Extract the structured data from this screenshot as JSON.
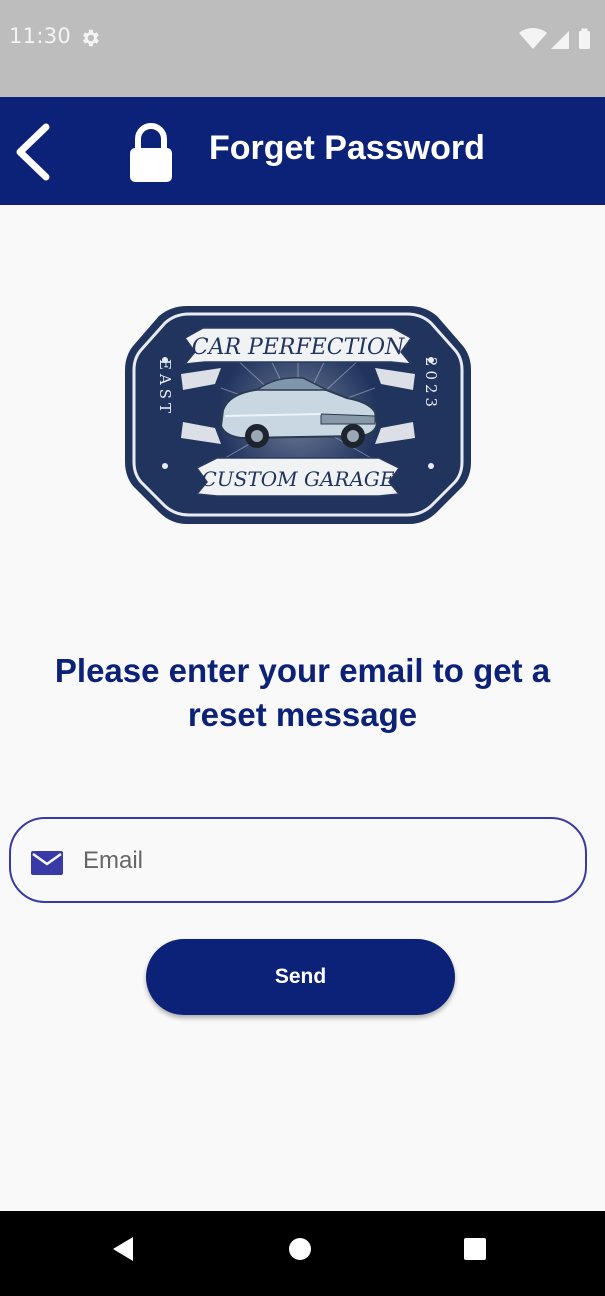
{
  "status_bar": {
    "time": "11:30",
    "icons": [
      "settings-gear-icon",
      "wifi-icon",
      "cellular-signal-icon",
      "battery-icon"
    ]
  },
  "app_bar": {
    "title": "Forget Password",
    "back_icon": "chevron-left-icon",
    "lock_icon": "lock-icon",
    "background": "#0C2178"
  },
  "logo": {
    "top_text": "CAR PERFECTION",
    "bottom_text": "CUSTOM GARAGE",
    "left_text": "EAST",
    "right_text": "2023"
  },
  "main": {
    "prompt": "Please enter your email to get a reset message",
    "email_field": {
      "placeholder": "Email",
      "value": "",
      "icon": "mail-icon"
    },
    "send_button": {
      "label": "Send"
    }
  },
  "nav_bar": {
    "icons": [
      "nav-back-icon",
      "nav-home-icon",
      "nav-recents-icon"
    ]
  },
  "colors": {
    "primary": "#0C2178",
    "accent": "#3A3AA6",
    "background": "#F9F9F9"
  }
}
